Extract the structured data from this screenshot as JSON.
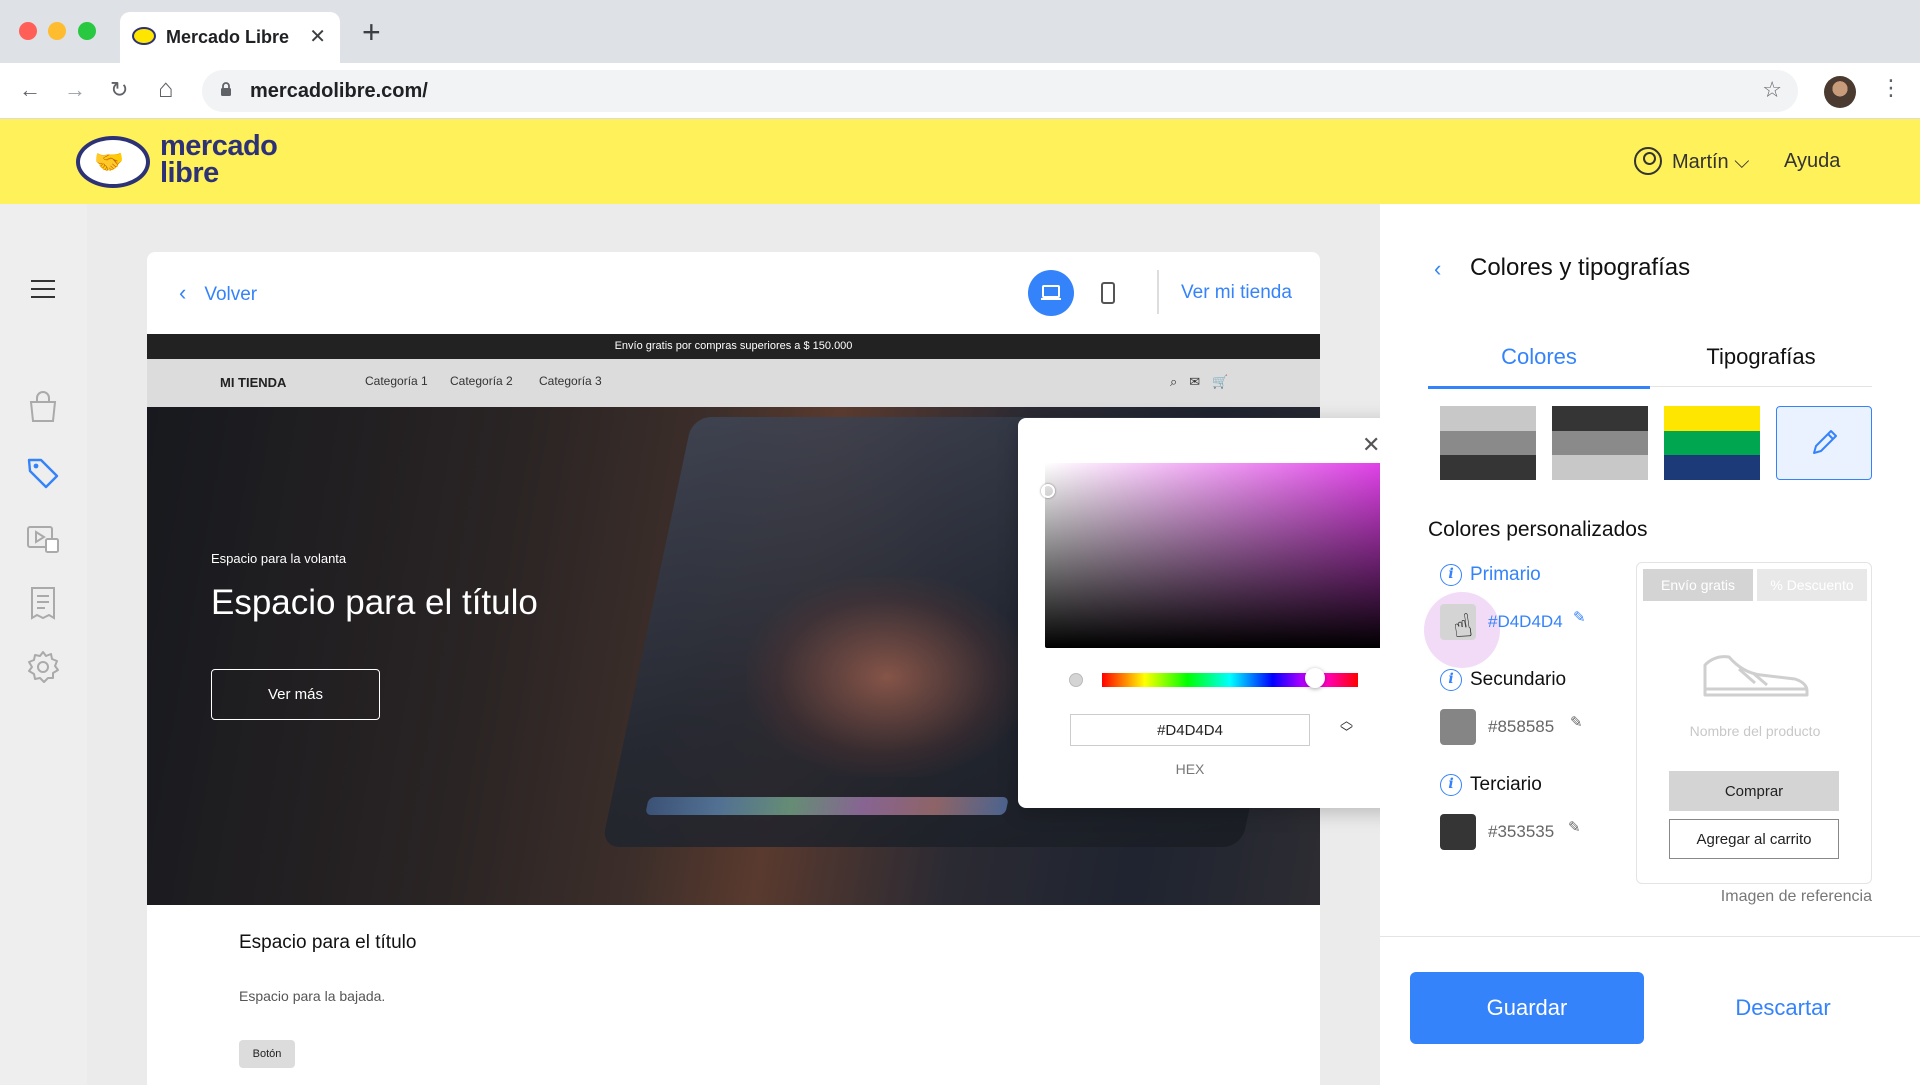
{
  "browser": {
    "tab_title": "Mercado Libre",
    "tab_close": "✕",
    "new_tab": "+",
    "url": "mercadolibre.com/",
    "back": "←",
    "forward": "→",
    "reload": "↻",
    "home": "⌂",
    "bookmark": "☆",
    "menu": "⋮"
  },
  "ml_header": {
    "logo_text_1": "mercado",
    "logo_text_2": "libre",
    "user_name": "Martín ⌵",
    "help": "Ayuda"
  },
  "preview": {
    "back_label": "Volver",
    "view_store": "Ver mi tienda",
    "promo": "Envío gratis por compras superiores a $ 150.000",
    "store_name": "MI TIENDA",
    "categories": [
      "Categoría 1",
      "Categoría 2",
      "Categoría 3"
    ],
    "store_icons": "⌕✉🛒",
    "hero_kicker": "Espacio para la volanta",
    "hero_title": "Espacio para el título",
    "hero_button": "Ver más",
    "section_title": "Espacio para el título",
    "section_sub": "Espacio para la bajada.",
    "section_button": "Botón"
  },
  "picker": {
    "close": "✕",
    "hex_value": "#D4D4D4",
    "hex_label": "HEX",
    "stepper": "⌃\n⌄"
  },
  "panel": {
    "title": "Colores y tipografías",
    "tab_colors": "Colores",
    "tab_fonts": "Tipografías",
    "custom_title": "Colores personalizados",
    "primary": {
      "label": "Primario",
      "hex": "#D4D4D4",
      "color": "#D4D4D4"
    },
    "secondary": {
      "label": "Secundario",
      "hex": "#858585",
      "color": "#858585"
    },
    "tertiary": {
      "label": "Terciario",
      "hex": "#353535",
      "color": "#353535"
    },
    "ref_tag_1": "Envío gratis",
    "ref_tag_2": "% Descuento",
    "ref_product": "Nombre del producto",
    "ref_buy": "Comprar",
    "ref_cart": "Agregar al carrito",
    "ref_caption": "Imagen de referencia",
    "save": "Guardar",
    "discard": "Descartar"
  },
  "palettes": [
    [
      "#c8c8c8",
      "#8a8a8a",
      "#353535"
    ],
    [
      "#353535",
      "#8a8a8a",
      "#c8c8c8"
    ],
    [
      "#ffe600",
      "#00a650",
      "#1d3a78"
    ]
  ],
  "colors": {
    "accent": "#3483fa",
    "brand_yellow": "#fff159"
  }
}
